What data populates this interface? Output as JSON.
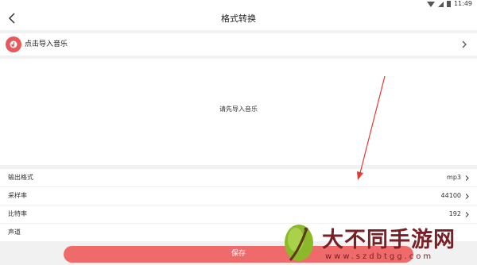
{
  "status_bar": {
    "time": "11:49"
  },
  "header": {
    "title": "格式转换"
  },
  "import_row": {
    "label": "点击导入音乐"
  },
  "preview": {
    "hint": "请先导入音乐"
  },
  "settings": [
    {
      "label": "输出格式",
      "value": "mp3"
    },
    {
      "label": "采样率",
      "value": "44100"
    },
    {
      "label": "比特率",
      "value": "192"
    },
    {
      "label": "声道",
      "value": ""
    }
  ],
  "save_button": {
    "label": "保存"
  },
  "watermark": {
    "text": "大不同手游网",
    "url": "www.szdbtgg.com"
  },
  "colors": {
    "accent": "#ef6b6b",
    "music_icon": "#e8585c",
    "annotation": "#e53935",
    "watermark": "#7a1f25"
  }
}
